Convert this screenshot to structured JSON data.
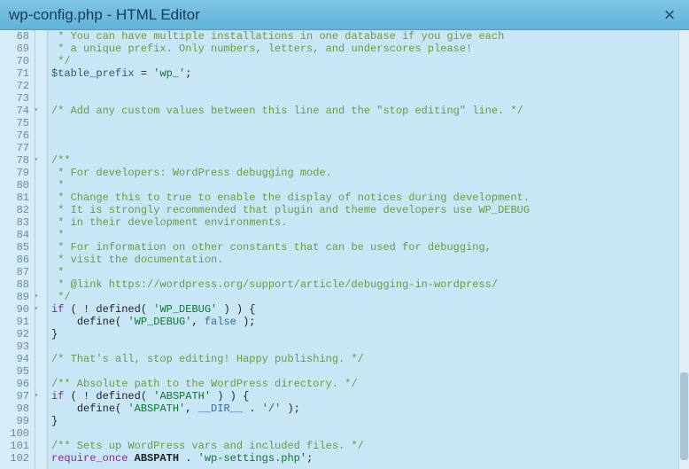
{
  "window": {
    "title": "wp-config.php - HTML Editor",
    "close_label": "×"
  },
  "editor": {
    "first_line": 68,
    "fold_lines": [
      74,
      78,
      89,
      90,
      97
    ],
    "lines": [
      [
        [
          "comment",
          " * You can have multiple installations in one database if you give each"
        ]
      ],
      [
        [
          "comment",
          " * a unique prefix. Only numbers, letters, and underscores please!"
        ]
      ],
      [
        [
          "comment",
          " */"
        ]
      ],
      [
        [
          "var",
          "$table_prefix"
        ],
        [
          "punc",
          " = "
        ],
        [
          "string",
          "'wp_'"
        ],
        [
          "punc",
          ";"
        ]
      ],
      [],
      [],
      [
        [
          "comment",
          "/* Add any custom values between this line and the \"stop editing\" line. */"
        ]
      ],
      [],
      [],
      [],
      [
        [
          "comment",
          "/**"
        ]
      ],
      [
        [
          "comment",
          " * For developers: WordPress debugging mode."
        ]
      ],
      [
        [
          "comment",
          " *"
        ]
      ],
      [
        [
          "comment",
          " * Change this to true to enable the display of notices during development."
        ]
      ],
      [
        [
          "comment",
          " * It is strongly recommended that plugin and theme developers use WP_DEBUG"
        ]
      ],
      [
        [
          "comment",
          " * in their development environments."
        ]
      ],
      [
        [
          "comment",
          " *"
        ]
      ],
      [
        [
          "comment",
          " * For information on other constants that can be used for debugging,"
        ]
      ],
      [
        [
          "comment",
          " * visit the documentation."
        ]
      ],
      [
        [
          "comment",
          " *"
        ]
      ],
      [
        [
          "comment",
          " * @link https://wordpress.org/support/article/debugging-in-wordpress/"
        ]
      ],
      [
        [
          "comment",
          " */"
        ]
      ],
      [
        [
          "keyword",
          "if"
        ],
        [
          "punc",
          " ( ! "
        ],
        [
          "func",
          "defined"
        ],
        [
          "punc",
          "( "
        ],
        [
          "string",
          "'WP_DEBUG'"
        ],
        [
          "punc",
          " ) ) {"
        ]
      ],
      [
        [
          "punc",
          "    "
        ],
        [
          "func",
          "define"
        ],
        [
          "punc",
          "( "
        ],
        [
          "string",
          "'WP_DEBUG'"
        ],
        [
          "punc",
          ", "
        ],
        [
          "const",
          "false"
        ],
        [
          "punc",
          " );"
        ]
      ],
      [
        [
          "punc",
          "}"
        ]
      ],
      [],
      [
        [
          "comment",
          "/* That's all, stop editing! Happy publishing. */"
        ]
      ],
      [],
      [
        [
          "comment",
          "/** Absolute path to the WordPress directory. */"
        ]
      ],
      [
        [
          "keyword",
          "if"
        ],
        [
          "punc",
          " ( ! "
        ],
        [
          "func",
          "defined"
        ],
        [
          "punc",
          "( "
        ],
        [
          "string",
          "'ABSPATH'"
        ],
        [
          "punc",
          " ) ) {"
        ]
      ],
      [
        [
          "punc",
          "    "
        ],
        [
          "func",
          "define"
        ],
        [
          "punc",
          "( "
        ],
        [
          "string",
          "'ABSPATH'"
        ],
        [
          "punc",
          ", "
        ],
        [
          "const",
          "__DIR__"
        ],
        [
          "punc",
          " . "
        ],
        [
          "string",
          "'/'"
        ],
        [
          "punc",
          " );"
        ]
      ],
      [
        [
          "punc",
          "}"
        ]
      ],
      [],
      [
        [
          "comment",
          "/** Sets up WordPress vars and included files. */"
        ]
      ],
      [
        [
          "keyword",
          "require_once"
        ],
        [
          "punc",
          " "
        ],
        [
          "id",
          "ABSPATH"
        ],
        [
          "punc",
          " . "
        ],
        [
          "string",
          "'wp-settings.php'"
        ],
        [
          "punc",
          ";"
        ]
      ]
    ]
  }
}
